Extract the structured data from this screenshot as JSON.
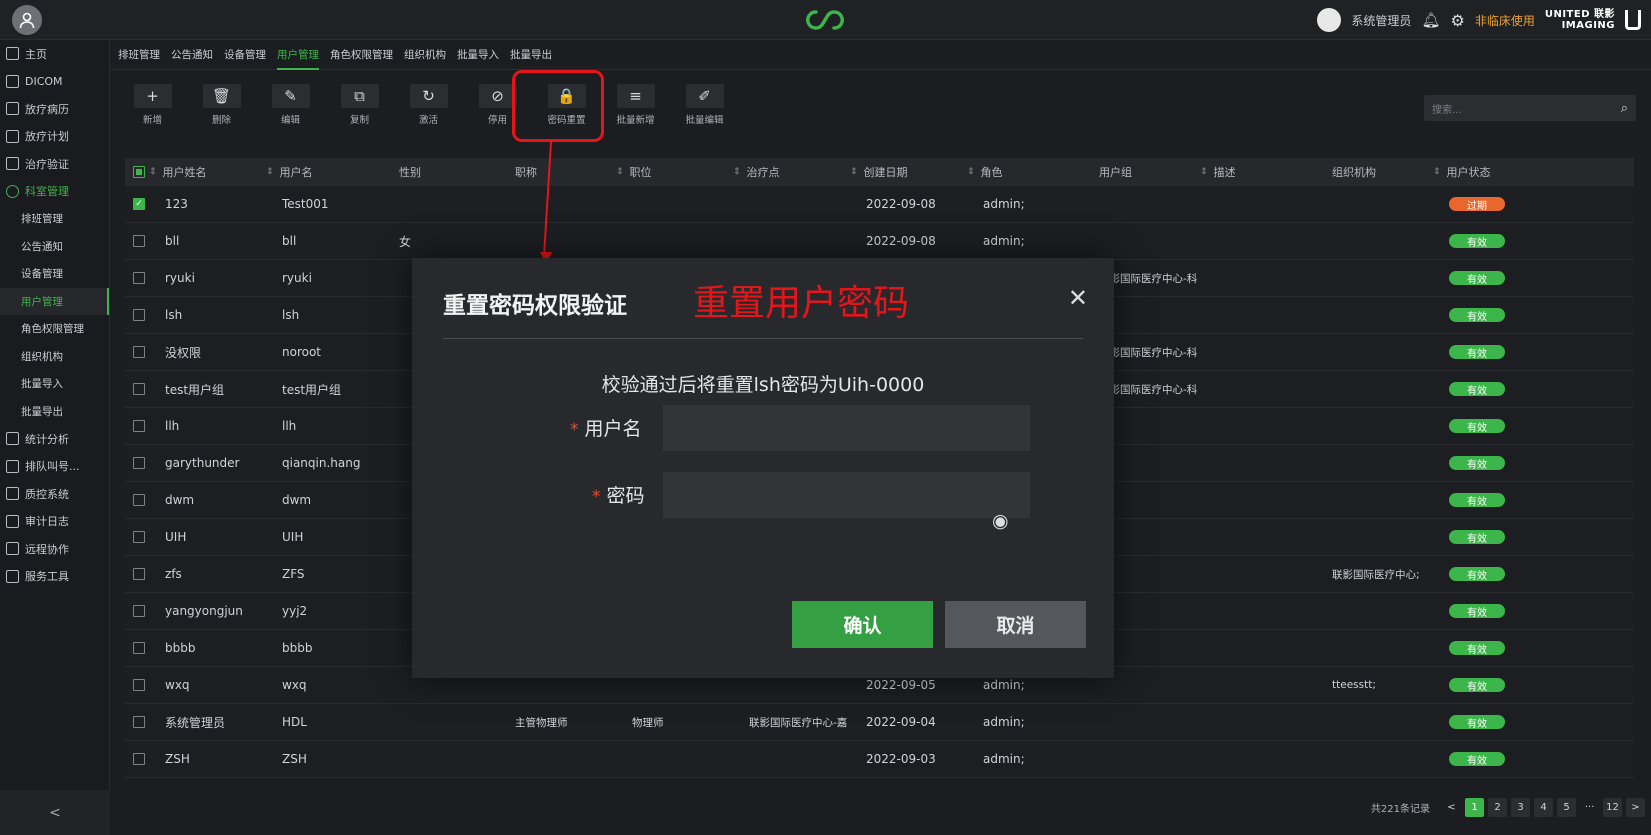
{
  "topbar": {
    "user_name": "系统管理员",
    "non_clinical": "非临床使用",
    "brand_line1": "UNITED 联影",
    "brand_line2": "IMAGING"
  },
  "sidebar": {
    "items": [
      {
        "label": "主页",
        "icon": "home-icon"
      },
      {
        "label": "DICOM",
        "icon": "dicom-icon"
      },
      {
        "label": "放疗病历",
        "icon": "record-icon"
      },
      {
        "label": "放疗计划",
        "icon": "plan-icon"
      },
      {
        "label": "治疗验证",
        "icon": "verify-icon"
      },
      {
        "label": "科室管理",
        "icon": "dept-icon",
        "active": true
      },
      {
        "label": "排班管理",
        "sub": true
      },
      {
        "label": "公告通知",
        "sub": true
      },
      {
        "label": "设备管理",
        "sub": true
      },
      {
        "label": "用户管理",
        "sub": true,
        "active": true
      },
      {
        "label": "角色权限管理",
        "sub": true
      },
      {
        "label": "组织机构",
        "sub": true
      },
      {
        "label": "批量导入",
        "sub": true
      },
      {
        "label": "批量导出",
        "sub": true
      },
      {
        "label": "统计分析",
        "icon": "stats-icon"
      },
      {
        "label": "排队叫号...",
        "icon": "queue-icon"
      },
      {
        "label": "质控系统",
        "icon": "qc-icon"
      },
      {
        "label": "审计日志",
        "icon": "audit-icon"
      },
      {
        "label": "远程协作",
        "icon": "remote-icon"
      },
      {
        "label": "服务工具",
        "icon": "tools-icon"
      }
    ]
  },
  "tabs": [
    "排班管理",
    "公告通知",
    "设备管理",
    "用户管理",
    "角色权限管理",
    "组织机构",
    "批量导入",
    "批量导出"
  ],
  "toolbar": [
    {
      "label": "新增",
      "glyph": "+"
    },
    {
      "label": "删除",
      "glyph": "🗑"
    },
    {
      "label": "编辑",
      "glyph": "✎"
    },
    {
      "label": "复制",
      "glyph": "⧉"
    },
    {
      "label": "激活",
      "glyph": "↻"
    },
    {
      "label": "停用",
      "glyph": "⊘"
    },
    {
      "label": "密码重置",
      "glyph": "🔒"
    },
    {
      "label": "批量新增",
      "glyph": "≡"
    },
    {
      "label": "批量编辑",
      "glyph": "✐"
    }
  ],
  "search": {
    "placeholder": "搜索..."
  },
  "table": {
    "headers": [
      "用户姓名",
      "用户名",
      "性别",
      "职称",
      "职位",
      "治疗点",
      "创建日期",
      "角色",
      "用户组",
      "描述",
      "组织机构",
      "用户状态"
    ],
    "rows": [
      {
        "checked": true,
        "name": "123",
        "username": "Test001",
        "gender": "",
        "title": "",
        "position": "",
        "site": "",
        "date": "2022-09-08",
        "role": "admin;",
        "group": "",
        "desc": "",
        "org": "",
        "status": "过期"
      },
      {
        "checked": false,
        "name": "bll",
        "username": "bll",
        "gender": "女",
        "title": "",
        "position": "",
        "site": "",
        "date": "2022-09-08",
        "role": "admin;",
        "group": "",
        "desc": "",
        "org": "",
        "status": "有效"
      },
      {
        "checked": false,
        "name": "ryuki",
        "username": "ryuki",
        "gender": "",
        "title": "",
        "position": "",
        "site": "",
        "date": "",
        "role": "",
        "group": "联影国际医疗中心-科",
        "desc": "",
        "org": "",
        "status": "有效"
      },
      {
        "checked": false,
        "name": "lsh",
        "username": "lsh",
        "gender": "",
        "title": "",
        "position": "",
        "site": "",
        "date": "",
        "role": "",
        "group": "",
        "desc": "",
        "org": "",
        "status": "有效"
      },
      {
        "checked": false,
        "name": "没权限",
        "username": "noroot",
        "gender": "",
        "title": "",
        "position": "",
        "site": "",
        "date": "",
        "role": "",
        "group": "联影国际医疗中心-科",
        "desc": "",
        "org": "",
        "status": "有效"
      },
      {
        "checked": false,
        "name": "test用户组",
        "username": "test用户组",
        "gender": "",
        "title": "",
        "position": "",
        "site": "",
        "date": "",
        "role": "",
        "group": "联影国际医疗中心-科",
        "desc": "",
        "org": "",
        "status": "有效"
      },
      {
        "checked": false,
        "name": "llh",
        "username": "llh",
        "gender": "",
        "title": "",
        "position": "",
        "site": "",
        "date": "",
        "role": "",
        "group": "",
        "desc": "",
        "org": "",
        "status": "有效"
      },
      {
        "checked": false,
        "name": "garythunder",
        "username": "qianqin.hang",
        "gender": "",
        "title": "",
        "position": "",
        "site": "",
        "date": "",
        "role": "",
        "group": "",
        "desc": "",
        "org": "",
        "status": "有效"
      },
      {
        "checked": false,
        "name": "dwm",
        "username": "dwm",
        "gender": "",
        "title": "",
        "position": "",
        "site": "",
        "date": "",
        "role": "",
        "group": "",
        "desc": "",
        "org": "",
        "status": "有效"
      },
      {
        "checked": false,
        "name": "UIH",
        "username": "UIH",
        "gender": "",
        "title": "",
        "position": "",
        "site": "",
        "date": "",
        "role": "",
        "group": "",
        "desc": "",
        "org": "",
        "status": "有效"
      },
      {
        "checked": false,
        "name": "zfs",
        "username": "ZFS",
        "gender": "",
        "title": "",
        "position": "",
        "site": "",
        "date": "",
        "role": "",
        "group": "",
        "desc": "",
        "org": "联影国际医疗中心;",
        "status": "有效"
      },
      {
        "checked": false,
        "name": "yangyongjun",
        "username": "yyj2",
        "gender": "",
        "title": "",
        "position": "",
        "site": "",
        "date": "",
        "role": "",
        "group": "",
        "desc": "",
        "org": "",
        "status": "有效"
      },
      {
        "checked": false,
        "name": "bbbb",
        "username": "bbbb",
        "gender": "",
        "title": "",
        "position": "",
        "site": "",
        "date": "",
        "role": "",
        "group": "",
        "desc": "",
        "org": "",
        "status": "有效"
      },
      {
        "checked": false,
        "name": "wxq",
        "username": "wxq",
        "gender": "",
        "title": "",
        "position": "",
        "site": "",
        "date": "2022-09-05",
        "role": "admin;",
        "group": "",
        "desc": "",
        "org": "tteesstt;",
        "status": "有效"
      },
      {
        "checked": false,
        "name": "系统管理员",
        "username": "HDL",
        "gender": "",
        "title": "主管物理师",
        "position": "物理师",
        "site": "联影国际医疗中心-嘉",
        "date": "2022-09-04",
        "role": "admin;",
        "group": "",
        "desc": "",
        "org": "",
        "status": "有效"
      },
      {
        "checked": false,
        "name": "ZSH",
        "username": "ZSH",
        "gender": "",
        "title": "",
        "position": "",
        "site": "",
        "date": "2022-09-03",
        "role": "admin;",
        "group": "",
        "desc": "",
        "org": "",
        "status": "有效"
      }
    ]
  },
  "pager": {
    "total": "共221条记录",
    "pages": [
      "1",
      "2",
      "3",
      "4",
      "5",
      "···",
      "12"
    ],
    "current": "1",
    "prev": "<",
    "next": ">"
  },
  "modal": {
    "title": "重置密码权限验证",
    "annotation": "重置用户密码",
    "close": "✕",
    "message": "校验通过后将重置lsh密码为Uih-0000",
    "username_label": "用户名",
    "password_label": "密码",
    "required_mark": "*",
    "username_value": "",
    "password_value": "",
    "confirm": "确认",
    "cancel": "取消"
  },
  "colors": {
    "accent": "#3cb54a",
    "expired": "#e8672c",
    "valid": "#3cb54a",
    "annotation": "#e5161a"
  }
}
